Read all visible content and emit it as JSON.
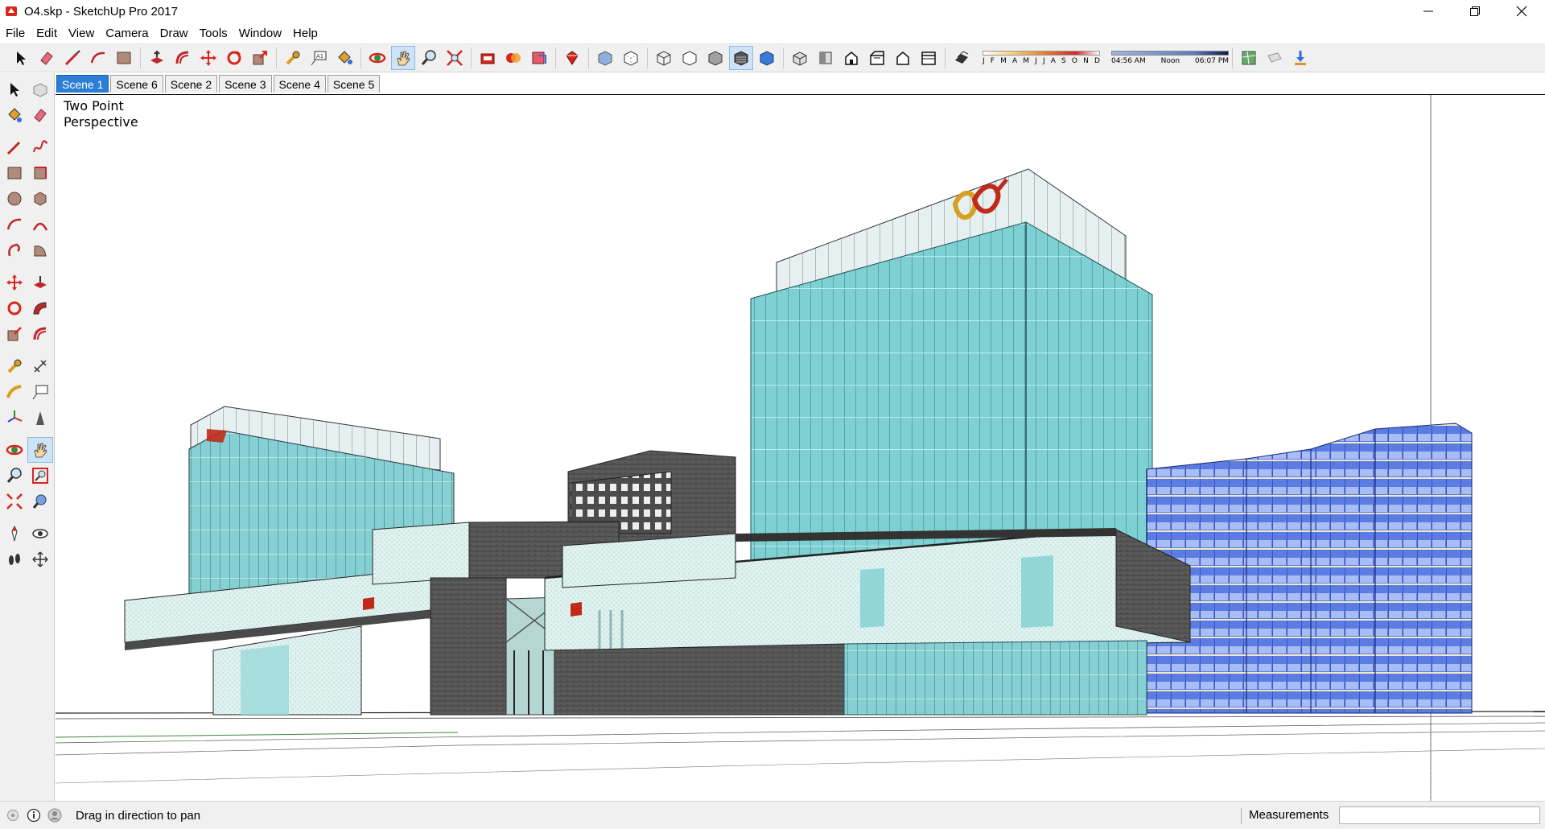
{
  "window": {
    "title": "O4.skp - SketchUp Pro 2017",
    "controls": [
      "minimize-icon",
      "restore-icon",
      "close-icon"
    ]
  },
  "menu": [
    "File",
    "Edit",
    "View",
    "Camera",
    "Draw",
    "Tools",
    "Window",
    "Help"
  ],
  "toolbar": {
    "tools": [
      "select-icon",
      "eraser-icon",
      "line-icon",
      "arc-icon",
      "rectangle-icon",
      "push-pull-icon",
      "offset-icon",
      "move-icon",
      "rotate-icon",
      "scale-icon",
      "tape-measure-icon",
      "text-icon",
      "paint-bucket-icon",
      "orbit-icon",
      "pan-icon",
      "zoom-icon",
      "zoom-extents-icon",
      "3d-warehouse-icon",
      "extension-warehouse-icon",
      "layout-icon",
      "extension-manager-icon",
      "xray-icon",
      "back-edges-icon",
      "wireframe-icon",
      "hidden-line-icon",
      "shaded-icon",
      "shaded-textures-icon",
      "monochrome-icon",
      "iso-view-icon",
      "top-view-icon",
      "front-view-icon",
      "right-view-icon",
      "back-view-icon",
      "left-view-icon",
      "display-shadows-icon"
    ],
    "active_tool": "pan-icon",
    "active_style": "shaded-textures-icon",
    "shadow": {
      "months": [
        "J",
        "F",
        "M",
        "A",
        "M",
        "J",
        "J",
        "A",
        "S",
        "O",
        "N",
        "D"
      ],
      "time_start": "04:56 AM",
      "time_mid": "Noon",
      "time_end": "06:07 PM"
    },
    "trailing_tools": [
      "geo-location-icon",
      "add-photo-texture-icon",
      "send-to-layout-icon"
    ]
  },
  "left_tools": [
    [
      "select-icon",
      "make-component-icon"
    ],
    [
      "paint-bucket-icon",
      "eraser-icon"
    ],
    [
      "line-icon",
      "freehand-icon"
    ],
    [
      "rectangle-icon",
      "rotated-rectangle-icon"
    ],
    [
      "circle-icon",
      "polygon-icon"
    ],
    [
      "arc-icon",
      "two-point-arc-icon"
    ],
    [
      "three-point-arc-icon",
      "pie-icon"
    ],
    [
      "move-icon",
      "push-pull-icon"
    ],
    [
      "rotate-icon",
      "follow-me-icon"
    ],
    [
      "scale-icon",
      "offset-icon"
    ],
    [
      "tape-measure-icon",
      "dimension-icon"
    ],
    [
      "protractor-icon",
      "text-icon"
    ],
    [
      "axes-icon",
      "3d-text-icon"
    ],
    [
      "orbit-icon",
      "pan-icon"
    ],
    [
      "zoom-icon",
      "zoom-window-icon"
    ],
    [
      "zoom-extents-icon",
      "previous-view-icon"
    ],
    [
      "position-camera-icon",
      "look-around-icon"
    ],
    [
      "walk-icon",
      "section-plane-icon"
    ]
  ],
  "scenes": {
    "tabs": [
      "Scene 1",
      "Scene 6",
      "Scene 2",
      "Scene 3",
      "Scene 4",
      "Scene 5"
    ],
    "active": "Scene 1"
  },
  "viewport": {
    "camera_label_line1": "Two Point",
    "camera_label_line2": "Perspective",
    "colors": {
      "glass_cyan": "#7fd0d2",
      "glass_blue": "#5a78e0",
      "dark_brick": "#555555",
      "light_panel": "#d9efee",
      "logo_red": "#d02a1a",
      "logo_gold": "#f0b020"
    }
  },
  "status": {
    "hint": "Drag in direction to pan",
    "measurements_label": "Measurements",
    "measurements_value": ""
  }
}
